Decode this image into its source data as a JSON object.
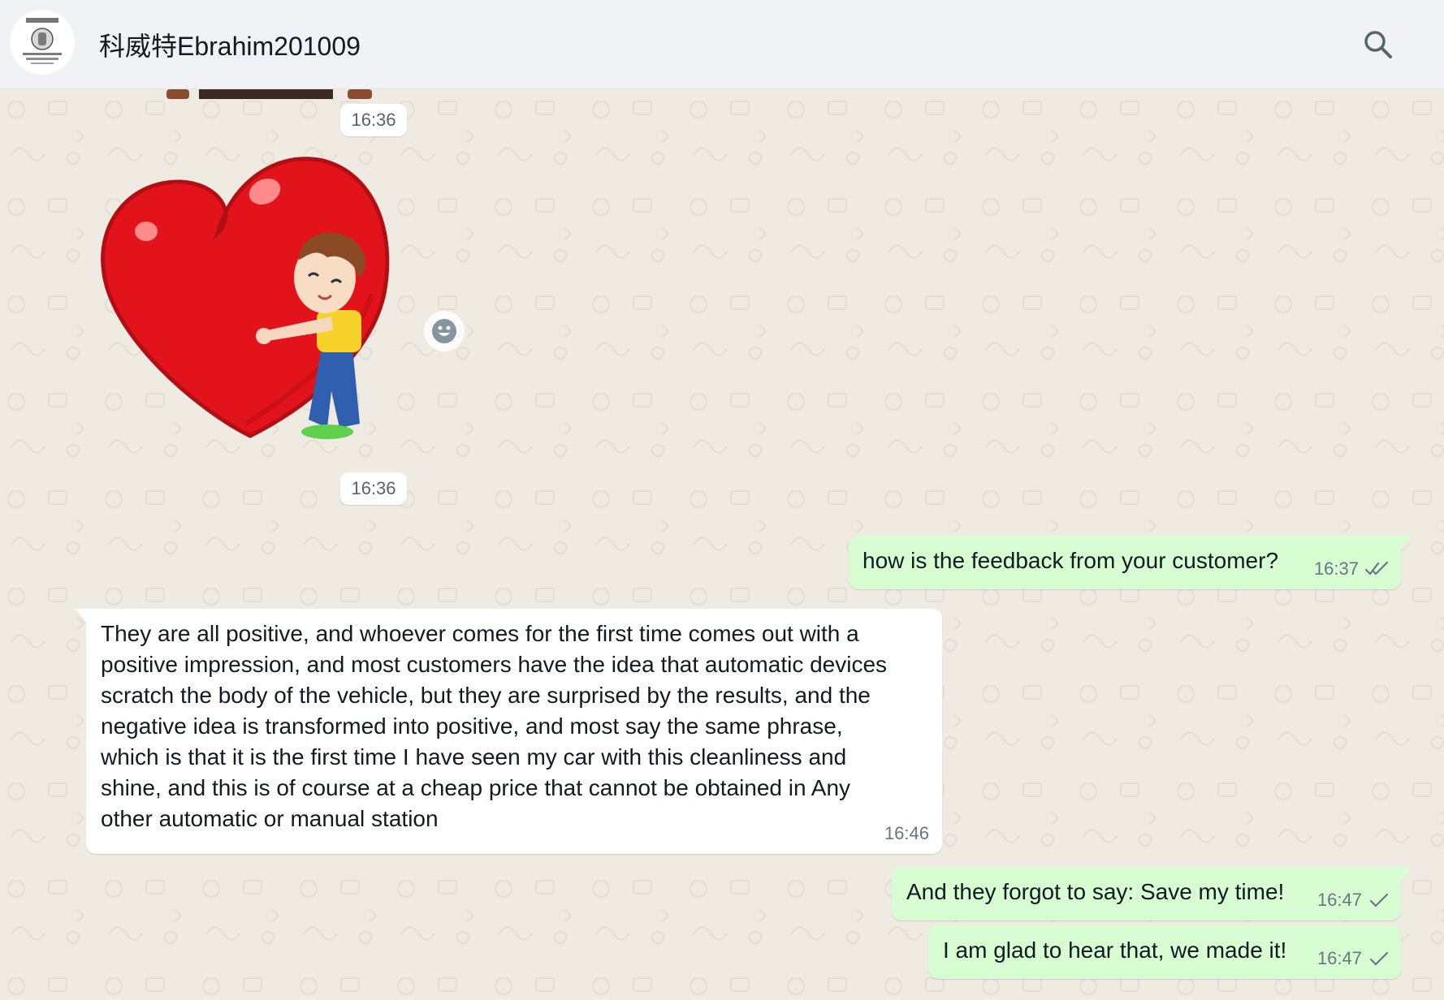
{
  "header": {
    "chat_title": "科威特Ebrahim201009"
  },
  "colors": {
    "header_bg": "#f0f2f5",
    "chat_bg": "#efeae2",
    "outgoing_bubble": "#d9fdd3",
    "incoming_bubble": "#ffffff",
    "read_tick": "#667781"
  },
  "icons": {
    "search": "search-icon",
    "reaction": "emoji-icon",
    "read_receipt": "double-check-icon",
    "sent_receipt": "single-check-icon"
  },
  "messages": [
    {
      "type": "image",
      "direction": "incoming",
      "time": "16:36"
    },
    {
      "type": "sticker",
      "direction": "incoming",
      "time": "16:36"
    },
    {
      "type": "text",
      "direction": "outgoing",
      "text": "how is the feedback from your customer?",
      "time": "16:37",
      "status": "read"
    },
    {
      "type": "text",
      "direction": "incoming",
      "lines": [
        "They are all positive, and whoever comes for the first time comes out with a",
        "positive impression, and most customers have the idea that automatic devices",
        "scratch the body of the vehicle, but they are surprised by the results, and the",
        "negative idea is transformed into positive, and most say the same phrase,",
        "which is that it is the first time I have seen my car with this cleanliness and",
        "shine, and this is of course at a cheap price that cannot be obtained in Any",
        "other automatic or manual station"
      ],
      "time": "16:46"
    },
    {
      "type": "text",
      "direction": "outgoing",
      "text": "And they forgot to say: Save my time!",
      "time": "16:47",
      "status": "sent"
    },
    {
      "type": "text",
      "direction": "outgoing",
      "text": "I am glad to hear that, we made it!",
      "time": "16:47",
      "status": "sent"
    }
  ]
}
